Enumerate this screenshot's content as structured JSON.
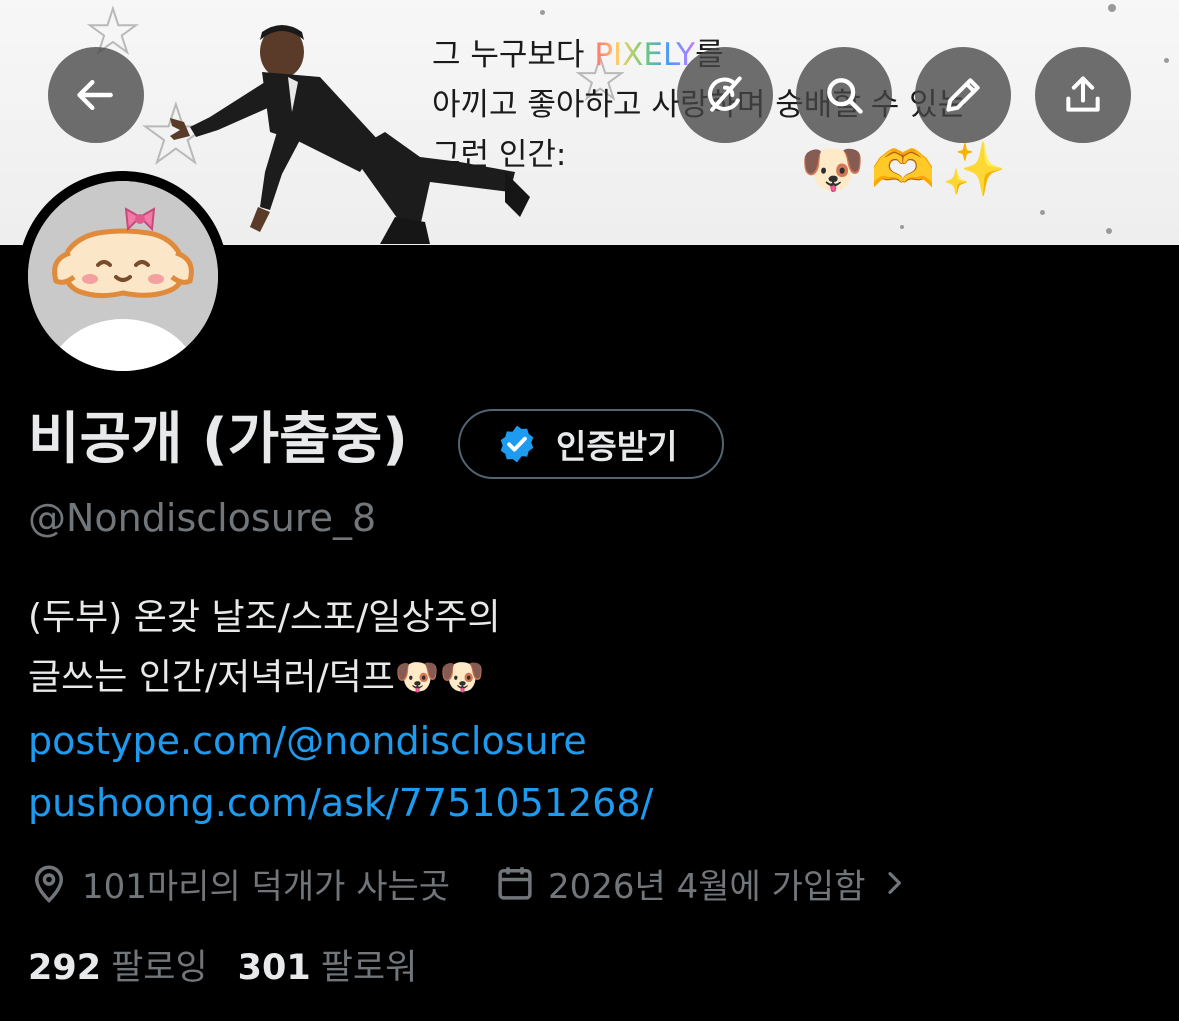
{
  "header": {
    "banner_text": {
      "line1_before": "그 누구보다 ",
      "line1_brand": "PIXELY",
      "line1_after": "를",
      "line2": "아끼고 좋아하고 사랑하며 숭배할 수 있는",
      "line3": "그런 인간:",
      "emojis": "🐶🫶✨"
    }
  },
  "profile": {
    "name": "비공개 (가출중)",
    "verify_label": "인증받기",
    "handle": "@Nondisclosure_8",
    "bio": [
      "(두부) 온갖 날조/스포/일상주의",
      "글쓰는 인간/저녁러/덕프🐶🐶"
    ],
    "links": [
      "postype.com/@nondisclosure",
      "pushoong.com/ask/7751051268/"
    ],
    "location": "101마리의 덕개가 사는곳",
    "joined": "2026년 4월에 가입함",
    "following_count": "292",
    "following_label": "팔로잉",
    "followers_count": "301",
    "followers_label": "팔로워"
  },
  "colors": {
    "accent": "#1d9bf0",
    "muted": "#71767b",
    "text": "#e7e9ea",
    "background": "#000000"
  },
  "icons": {
    "back": "arrow-left-icon",
    "grok": "grok-icon",
    "search": "search-icon",
    "edit": "pencil-icon",
    "share": "share-icon",
    "verified": "verified-badge-icon",
    "location": "location-pin-icon",
    "calendar": "calendar-icon",
    "chevron": "chevron-right-icon"
  }
}
